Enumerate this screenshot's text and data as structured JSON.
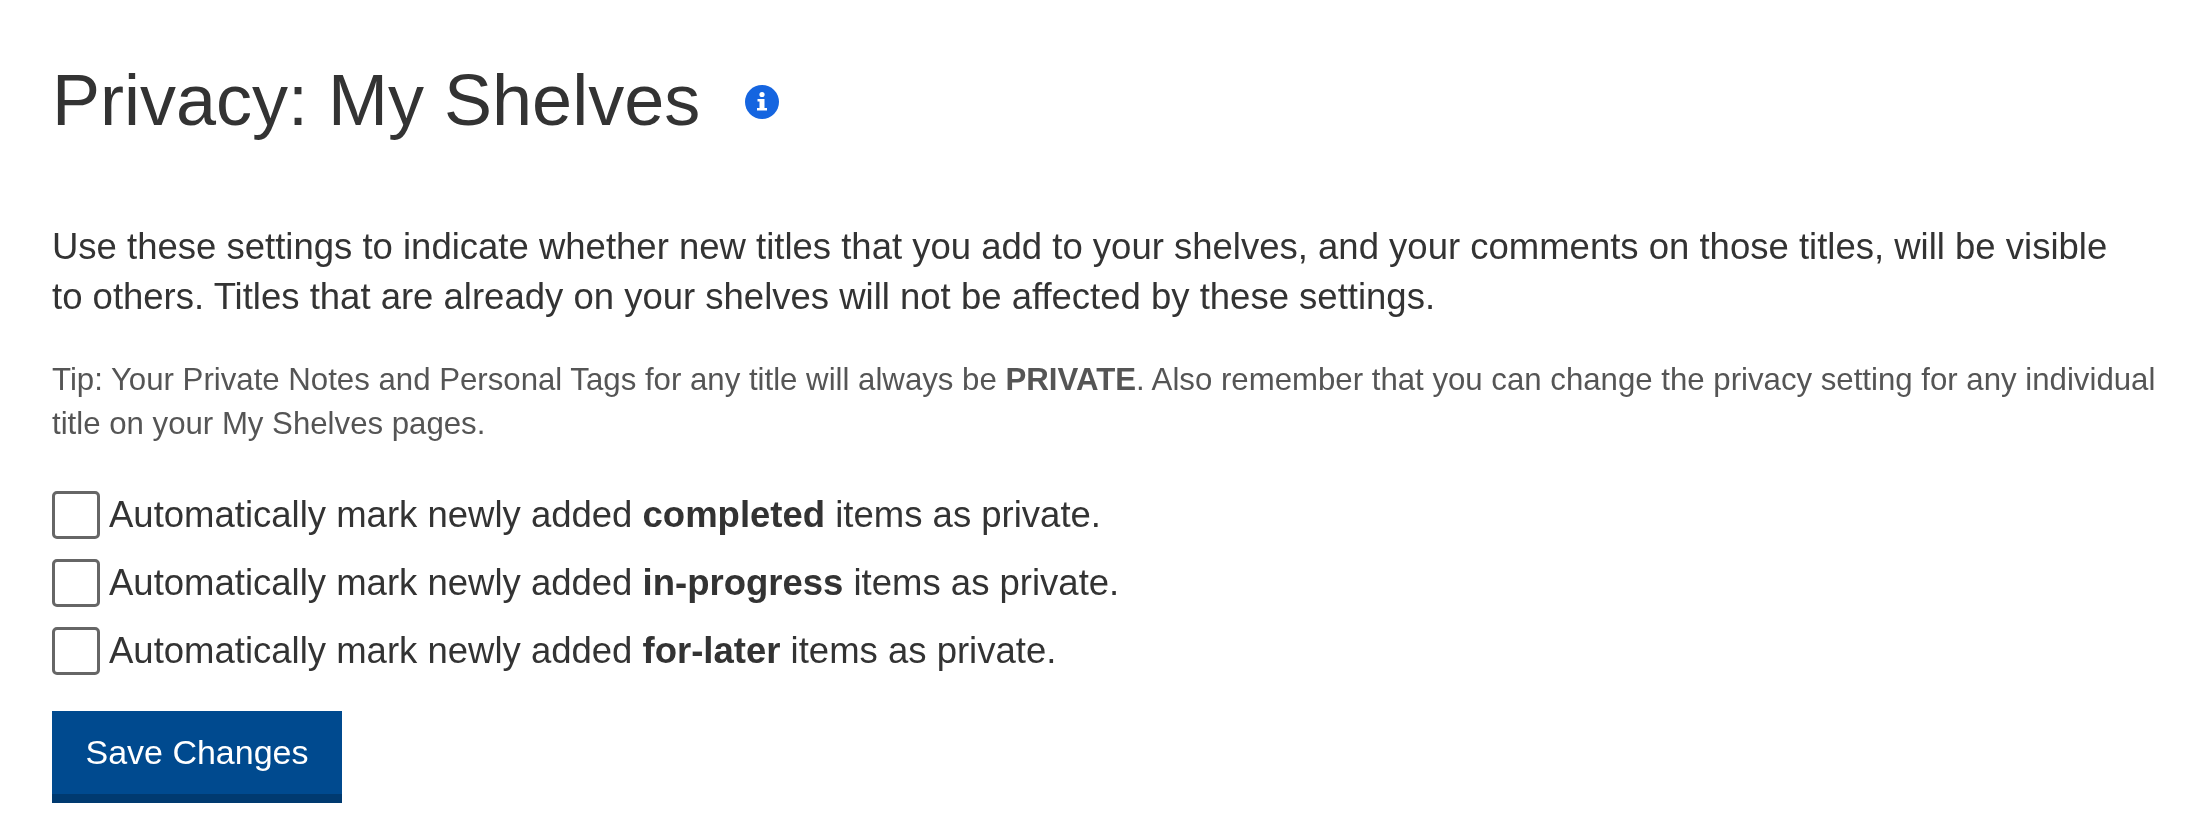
{
  "page": {
    "title": "Privacy: My Shelves"
  },
  "intro": "Use these settings to indicate whether new titles that you add to your shelves, and your comments on those titles, will be visible to others. Titles that are already on your shelves will not be affected by these settings.",
  "tip": "Tip: Your Private Notes and Personal Tags for any title will always be **PRIVATE**. Also remember that you can change the privacy setting for any individual title on your My Shelves pages.",
  "options": [
    {
      "label": "Automatically mark newly added **completed** items as private.",
      "checked": false
    },
    {
      "label": "Automatically mark newly added **in-progress** items as private.",
      "checked": false
    },
    {
      "label": "Automatically mark newly added **for-later** items as private.",
      "checked": false
    }
  ],
  "buttons": [
    {
      "label": "Save Changes"
    }
  ]
}
